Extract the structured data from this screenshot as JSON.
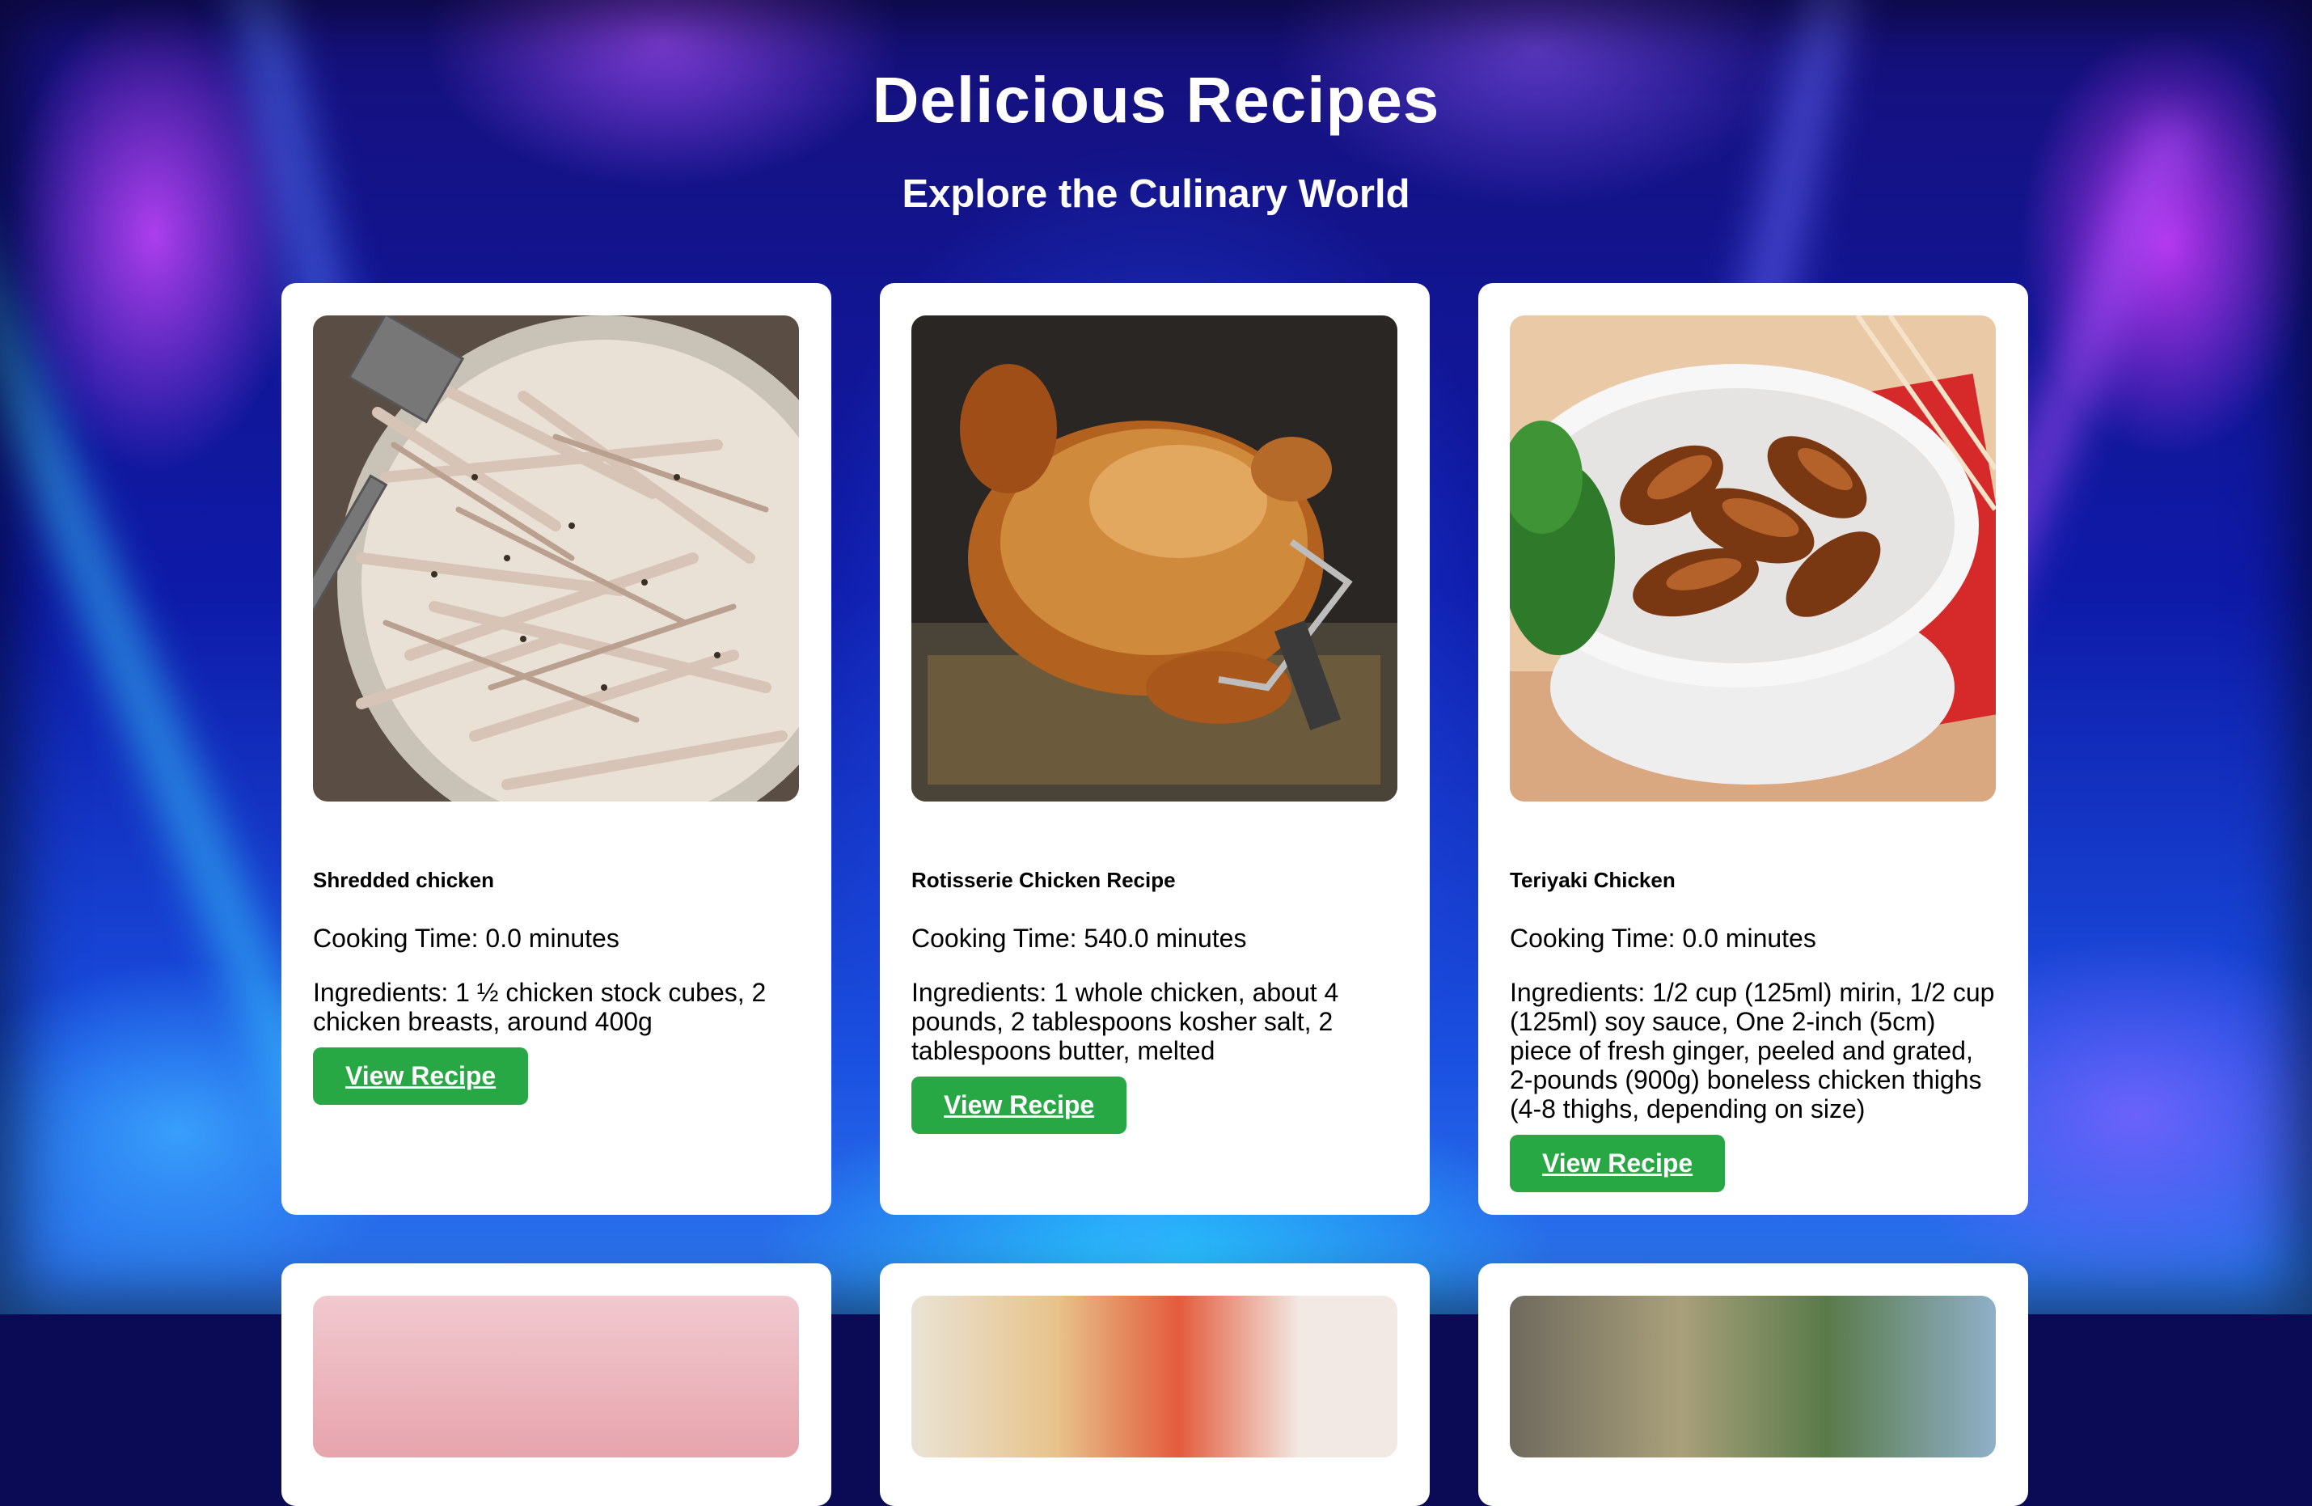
{
  "header": {
    "title": "Delicious Recipes",
    "subtitle": "Explore the Culinary World"
  },
  "recipes": [
    {
      "image_icon": "shredded-chicken-photo",
      "title": "Shredded chicken",
      "cooking_time": "Cooking Time: 0.0 minutes",
      "ingredients": "Ingredients: 1 ½ chicken stock cubes, 2 chicken breasts, around 400g",
      "button_label": "View Recipe"
    },
    {
      "image_icon": "rotisserie-chicken-photo",
      "title": "Rotisserie Chicken Recipe",
      "cooking_time": "Cooking Time: 540.0 minutes",
      "ingredients": "Ingredients: 1 whole chicken, about 4 pounds, 2 tablespoons kosher salt, 2 tablespoons butter, melted",
      "button_label": "View Recipe"
    },
    {
      "image_icon": "teriyaki-chicken-photo",
      "title": "Teriyaki Chicken",
      "cooking_time": "Cooking Time: 0.0 minutes",
      "ingredients": "Ingredients: 1/2 cup (125ml) mirin, 1/2 cup (125ml) soy sauce, One 2-inch (5cm) piece of fresh ginger, peeled and grated, 2-pounds (900g) boneless chicken thighs (4-8 thighs, depending on size)",
      "button_label": "View Recipe"
    }
  ],
  "colors": {
    "button": "#28a745",
    "card": "#ffffff",
    "header_text": "#ffffff"
  }
}
